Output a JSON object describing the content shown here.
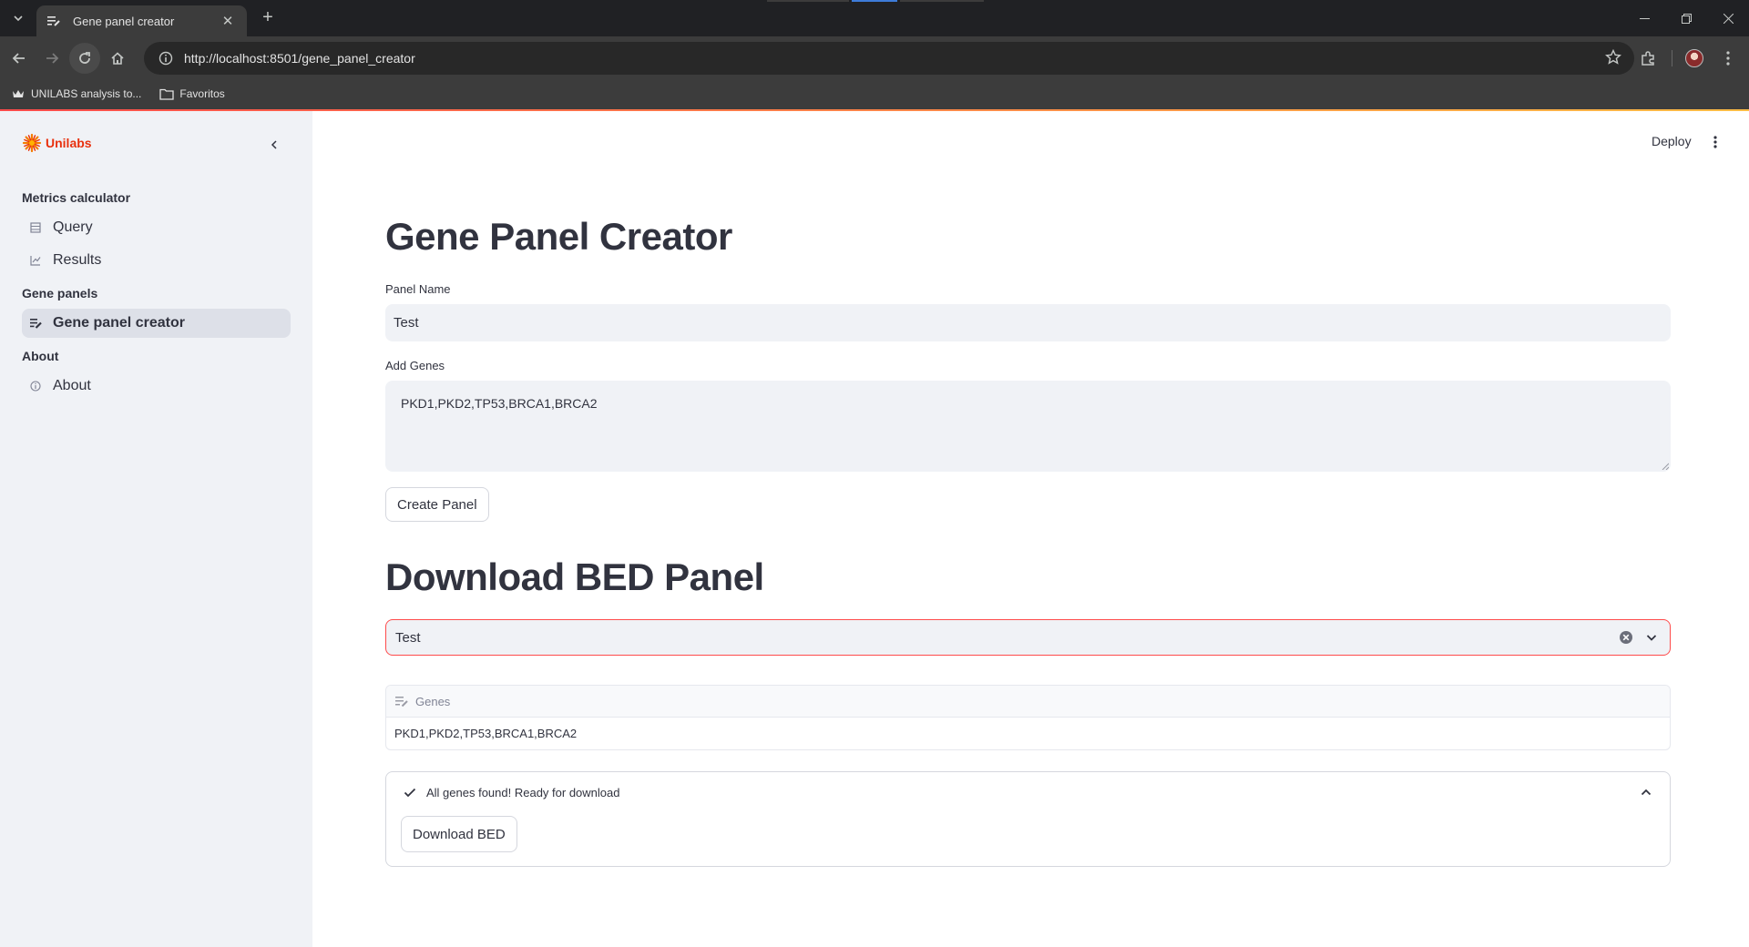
{
  "browser": {
    "tab_title": "Gene panel creator",
    "url": "http://localhost:8501/gene_panel_creator",
    "bookmarks": [
      {
        "label": "UNILABS analysis to..."
      },
      {
        "label": "Favoritos"
      }
    ]
  },
  "sidebar": {
    "logo_text": "Unilabs",
    "sections": [
      {
        "title": "Metrics calculator",
        "items": [
          {
            "label": "Query",
            "icon": "table-icon"
          },
          {
            "label": "Results",
            "icon": "chart-icon"
          }
        ]
      },
      {
        "title": "Gene panels",
        "items": [
          {
            "label": "Gene panel creator",
            "icon": "edit-list-icon",
            "selected": true
          }
        ]
      },
      {
        "title": "About",
        "items": [
          {
            "label": "About",
            "icon": "info-icon"
          }
        ]
      }
    ]
  },
  "header": {
    "deploy_label": "Deploy"
  },
  "main": {
    "title": "Gene Panel Creator",
    "panel_name_label": "Panel Name",
    "panel_name_value": "Test",
    "add_genes_label": "Add Genes",
    "add_genes_value": "PKD1,PKD2,TP53,BRCA1,BRCA2",
    "create_button": "Create Panel",
    "download_title": "Download BED Panel",
    "select_value": "Test",
    "table": {
      "column": "Genes",
      "value": "PKD1,PKD2,TP53,BRCA1,BRCA2"
    },
    "expander": {
      "status": "All genes found! Ready for download",
      "download_button": "Download BED"
    }
  },
  "colors": {
    "accent": "#ff4b4b",
    "brand": "#e8310e",
    "sidebar_bg": "#f0f2f6",
    "text": "#31333f"
  }
}
